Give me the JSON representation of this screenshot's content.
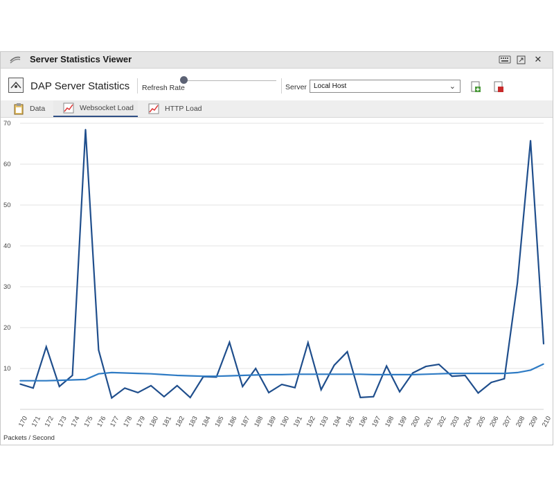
{
  "window": {
    "title": "Server Statistics Viewer"
  },
  "toolbar": {
    "app_title": "DAP Server Statistics",
    "refresh_label": "Refresh Rate",
    "refresh_rate_fraction": 0.0,
    "server_label": "Server",
    "server_value": "Local Host"
  },
  "tabs": [
    {
      "label": "Data",
      "icon": "clipboard-icon",
      "active": false
    },
    {
      "label": "Websocket Load",
      "icon": "line-chart-icon",
      "active": true
    },
    {
      "label": "HTTP Load",
      "icon": "line-chart-icon",
      "active": false
    }
  ],
  "colors": {
    "series_raw": "#1f4e8c",
    "series_avg": "#2e7bc4",
    "grid": "#e3e3e3",
    "tab_active_underline": "#2f4f85"
  },
  "chart_data": {
    "type": "line",
    "xlabel": "Packets / Second",
    "ylabel": "",
    "ylim": [
      0,
      70
    ],
    "yticks": [
      10,
      20,
      30,
      40,
      50,
      60,
      70
    ],
    "grid": true,
    "categories": [
      "170",
      "171",
      "172",
      "173",
      "174",
      "175",
      "176",
      "177",
      "178",
      "179",
      "180",
      "181",
      "182",
      "183",
      "184",
      "185",
      "186",
      "187",
      "188",
      "189",
      "190",
      "191",
      "192",
      "193",
      "194",
      "195",
      "196",
      "197",
      "198",
      "199",
      "200",
      "201",
      "202",
      "203",
      "204",
      "205",
      "206",
      "207",
      "208",
      "209",
      "210"
    ],
    "series": [
      {
        "values": [
          6.2,
          5.2,
          15.3,
          5.6,
          8.3,
          68.5,
          14.5,
          2.8,
          5.2,
          4.1,
          5.8,
          3.1,
          5.8,
          2.9,
          8.0,
          7.9,
          16.4,
          5.6,
          10.0,
          4.1,
          6.1,
          5.3,
          16.3,
          4.8,
          10.8,
          14.1,
          2.9,
          3.1,
          10.6,
          4.3,
          8.9,
          10.5,
          11.0,
          8.1,
          8.3,
          4.0,
          6.6,
          7.5,
          31.0,
          65.8,
          16.0
        ]
      },
      {
        "values": [
          7.0,
          7.0,
          7.0,
          7.1,
          7.2,
          7.3,
          8.7,
          9.0,
          8.9,
          8.8,
          8.7,
          8.5,
          8.3,
          8.2,
          8.1,
          8.1,
          8.2,
          8.3,
          8.4,
          8.5,
          8.5,
          8.6,
          8.6,
          8.6,
          8.6,
          8.6,
          8.6,
          8.5,
          8.5,
          8.5,
          8.5,
          8.6,
          8.7,
          8.8,
          8.8,
          8.8,
          8.8,
          8.8,
          9.0,
          9.6,
          11.1
        ]
      }
    ]
  }
}
